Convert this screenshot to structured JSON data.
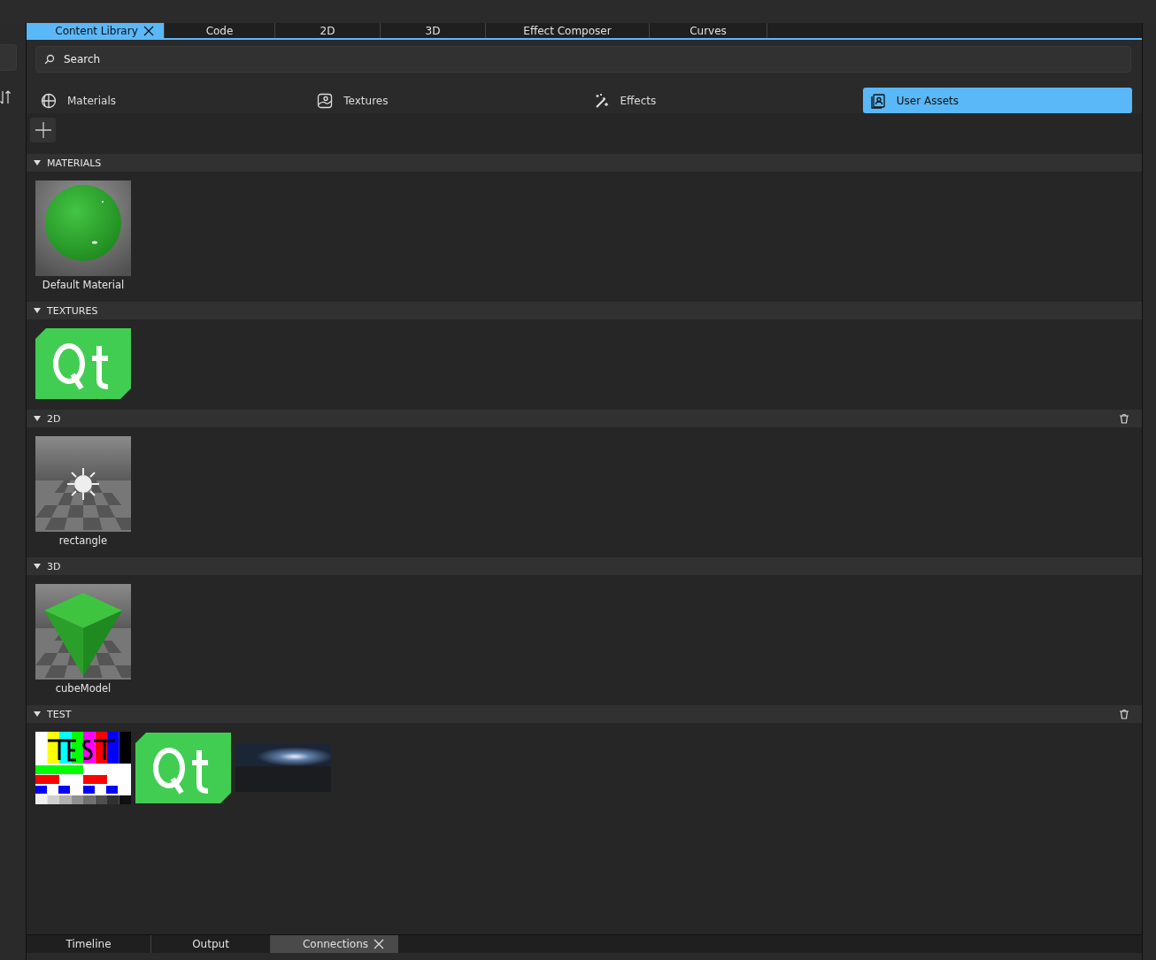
{
  "editor_tabs": [
    {
      "label": "Content Library",
      "selected": true,
      "closable": true
    },
    {
      "label": "Code",
      "selected": false,
      "closable": false
    },
    {
      "label": "2D",
      "selected": false,
      "closable": false
    },
    {
      "label": "3D",
      "selected": false,
      "closable": false
    },
    {
      "label": "Effect Composer",
      "selected": false,
      "closable": false
    },
    {
      "label": "Curves",
      "selected": false,
      "closable": false
    }
  ],
  "search": {
    "placeholder": "Search"
  },
  "categories": [
    {
      "label": "Materials",
      "kind": "materials",
      "selected": false
    },
    {
      "label": "Textures",
      "kind": "textures",
      "selected": false
    },
    {
      "label": "Effects",
      "kind": "effects",
      "selected": false
    },
    {
      "label": "User Assets",
      "kind": "user",
      "selected": true
    }
  ],
  "sections": [
    {
      "title": "MATERIALS",
      "expanded": true,
      "deletable": false,
      "items": [
        {
          "kind": "material",
          "label": "Default Material"
        }
      ]
    },
    {
      "title": "TEXTURES",
      "expanded": true,
      "deletable": false,
      "items": [
        {
          "kind": "qt"
        }
      ]
    },
    {
      "title": "2D",
      "expanded": true,
      "deletable": true,
      "items": [
        {
          "kind": "sprite",
          "label": "rectangle"
        }
      ]
    },
    {
      "title": "3D",
      "expanded": true,
      "deletable": false,
      "items": [
        {
          "kind": "model",
          "label": "cubeModel"
        }
      ]
    },
    {
      "title": "TEST",
      "expanded": true,
      "deletable": true,
      "items": [
        {
          "kind": "testcard"
        },
        {
          "kind": "qt"
        },
        {
          "kind": "hdr"
        }
      ]
    }
  ],
  "bottom_tabs": [
    {
      "label": "Timeline",
      "selected": false,
      "closable": false
    },
    {
      "label": "Output",
      "selected": false,
      "closable": false
    },
    {
      "label": "Connections",
      "selected": true,
      "closable": true
    }
  ]
}
